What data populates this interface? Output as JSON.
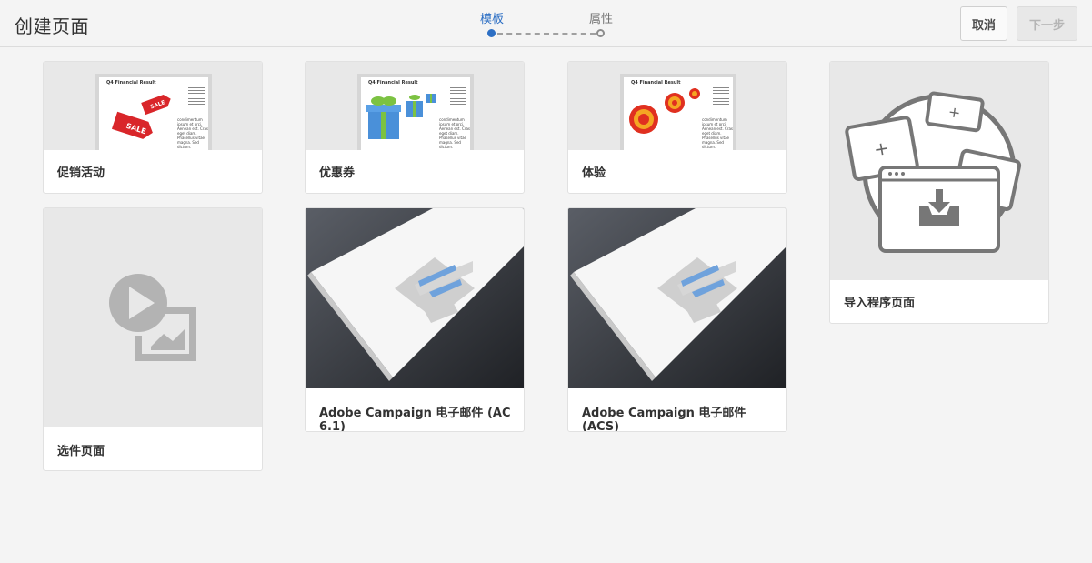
{
  "header": {
    "title": "创建页面",
    "steps": [
      {
        "label": "模板",
        "active": true
      },
      {
        "label": "属性",
        "active": false
      }
    ],
    "cancel_label": "取消",
    "next_label": "下一步"
  },
  "colors": {
    "accent": "#2d6fc4",
    "background": "#f4f4f4",
    "card": "#ffffff"
  },
  "templates": [
    {
      "label": "促销活动",
      "icon": "sale-tags-icon",
      "doc_title": "Q4 Financial Result",
      "doc_text": "condimentum ipsum et orci. Aenean est. Cras eget diam. Phasellus vitae magna. Sed dictum."
    },
    {
      "label": "优惠券",
      "icon": "gift-box-icon",
      "doc_title": "Q4 Financial Result",
      "doc_text": "condimentum ipsum et orci. Aenean est. Cras eget diam. Phasellus vitae magna. Sed dictum."
    },
    {
      "label": "体验",
      "icon": "target-icon",
      "doc_title": "Q4 Financial Result",
      "doc_text": "condimentum ipsum et orci. Aenean est. Cras eget diam. Phasellus vitae magna. Sed dictum."
    },
    {
      "label": "导入程序页面",
      "icon": "import-page-icon"
    },
    {
      "label": "选件页面",
      "icon": "video-image-icon"
    },
    {
      "label": "Adobe Campaign 电子邮件 (AC 6.1)",
      "icon": "email-envelope-icon"
    },
    {
      "label": "Adobe Campaign 电子邮件 (ACS)",
      "icon": "email-envelope-icon"
    }
  ]
}
